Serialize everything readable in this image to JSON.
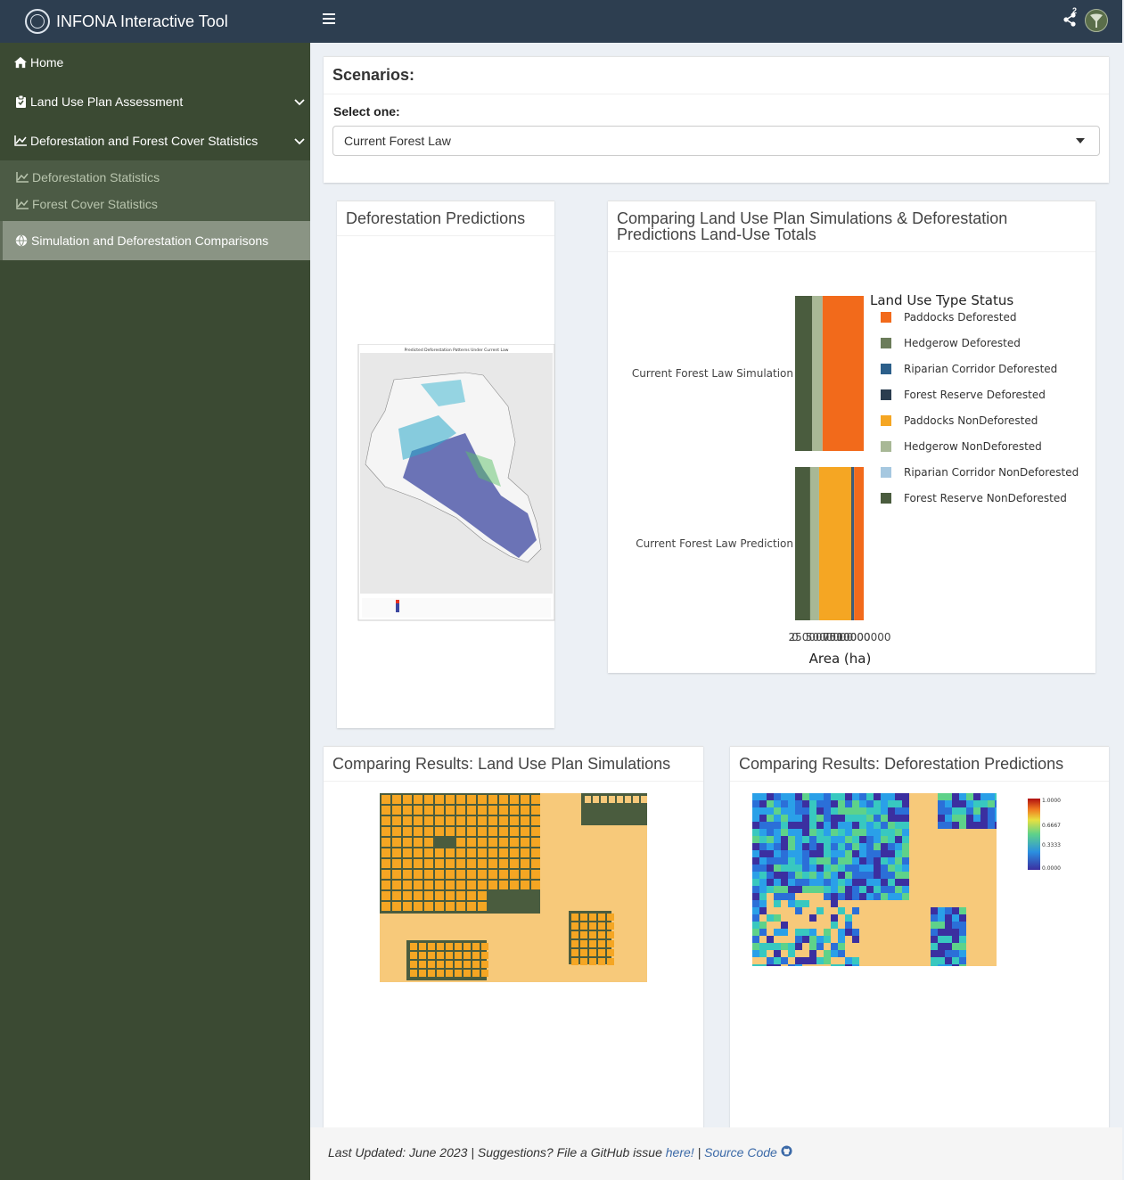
{
  "app": {
    "title": "INFONA Interactive Tool"
  },
  "sidebar": {
    "items": [
      {
        "label": "Home",
        "icon": "home-icon"
      },
      {
        "label": "Land Use Plan Assessment",
        "icon": "clipboard-icon"
      },
      {
        "label": "Deforestation and Forest Cover Statistics",
        "icon": "line-chart-icon"
      }
    ],
    "subitems": [
      {
        "label": "Deforestation Statistics",
        "icon": "line-chart-icon"
      },
      {
        "label": "Forest Cover Statistics",
        "icon": "line-chart-icon"
      }
    ],
    "active": {
      "label": "Simulation and Deforestation Comparisons",
      "icon": "globe-icon"
    }
  },
  "header": {
    "share_count": "2"
  },
  "scenarios": {
    "title": "Scenarios:",
    "select_label": "Select one:",
    "selected": "Current Forest Law"
  },
  "deforestation_box": {
    "title": "Deforestation Predictions",
    "map_title": "Predicted Deforestation Patterns Under Current Law"
  },
  "compare_box": {
    "title_line1": "Comparing Land Use Plan Simulations & Deforestation",
    "title_line2": "Predictions Land-Use Totals"
  },
  "lup_box": {
    "title": "Comparing Results: Land Use Plan Simulations"
  },
  "pred_box": {
    "title": "Comparing Results: Deforestation Predictions",
    "colorbar_ticks": [
      "1.0000",
      "0.6667",
      "0.3333",
      "0.0000"
    ]
  },
  "footer": {
    "text": "Last Updated: June 2023 | Suggestions? File a GitHub issue ",
    "link1": "here!",
    "sep": " | ",
    "link2": "Source Code"
  },
  "colors": {
    "sidebar": "#3b4a33",
    "header": "#2d3e50",
    "paddocks_deforested": "#f26a1b",
    "hedgerow_deforested": "#6b7c5a",
    "riparian_deforested": "#2c5f8a",
    "forest_reserve_deforested": "#2a3d4f",
    "paddocks_nondeforested": "#f5a623",
    "hedgerow_nondeforested": "#a8b896",
    "riparian_nondeforested": "#a6c8e0",
    "forest_reserve_nondeforested": "#4a5c3e"
  },
  "chart_data": {
    "type": "bar",
    "orientation": "horizontal",
    "stacked": true,
    "categories": [
      "Current Forest Law Simulation",
      "Current Forest Law Prediction"
    ],
    "xlabel": "Area (ha)",
    "x_tick_labels": [
      "0",
      "2500000",
      "5000000",
      "7500000",
      "10000000"
    ],
    "xlim": [
      0,
      10000000
    ],
    "legend_title": "Land Use Type Status",
    "legend_position": "right",
    "series": [
      {
        "name": "Paddocks Deforested",
        "values": [
          6000000,
          1400000
        ],
        "color": "#f26a1b"
      },
      {
        "name": "Hedgerow Deforested",
        "values": [
          0,
          0
        ],
        "color": "#6b7c5a"
      },
      {
        "name": "Riparian Corridor Deforested",
        "values": [
          0,
          200000
        ],
        "color": "#2c5f8a"
      },
      {
        "name": "Forest Reserve Deforested",
        "values": [
          0,
          200000
        ],
        "color": "#2a3d4f"
      },
      {
        "name": "Paddocks NonDeforested",
        "values": [
          0,
          4700000
        ],
        "color": "#f5a623"
      },
      {
        "name": "Hedgerow NonDeforested",
        "values": [
          1500000,
          1300000
        ],
        "color": "#a8b896"
      },
      {
        "name": "Riparian Corridor NonDeforested",
        "values": [
          0,
          0
        ],
        "color": "#a6c8e0"
      },
      {
        "name": "Forest Reserve NonDeforested",
        "values": [
          2500000,
          2200000
        ],
        "color": "#4a5c3e"
      }
    ]
  }
}
